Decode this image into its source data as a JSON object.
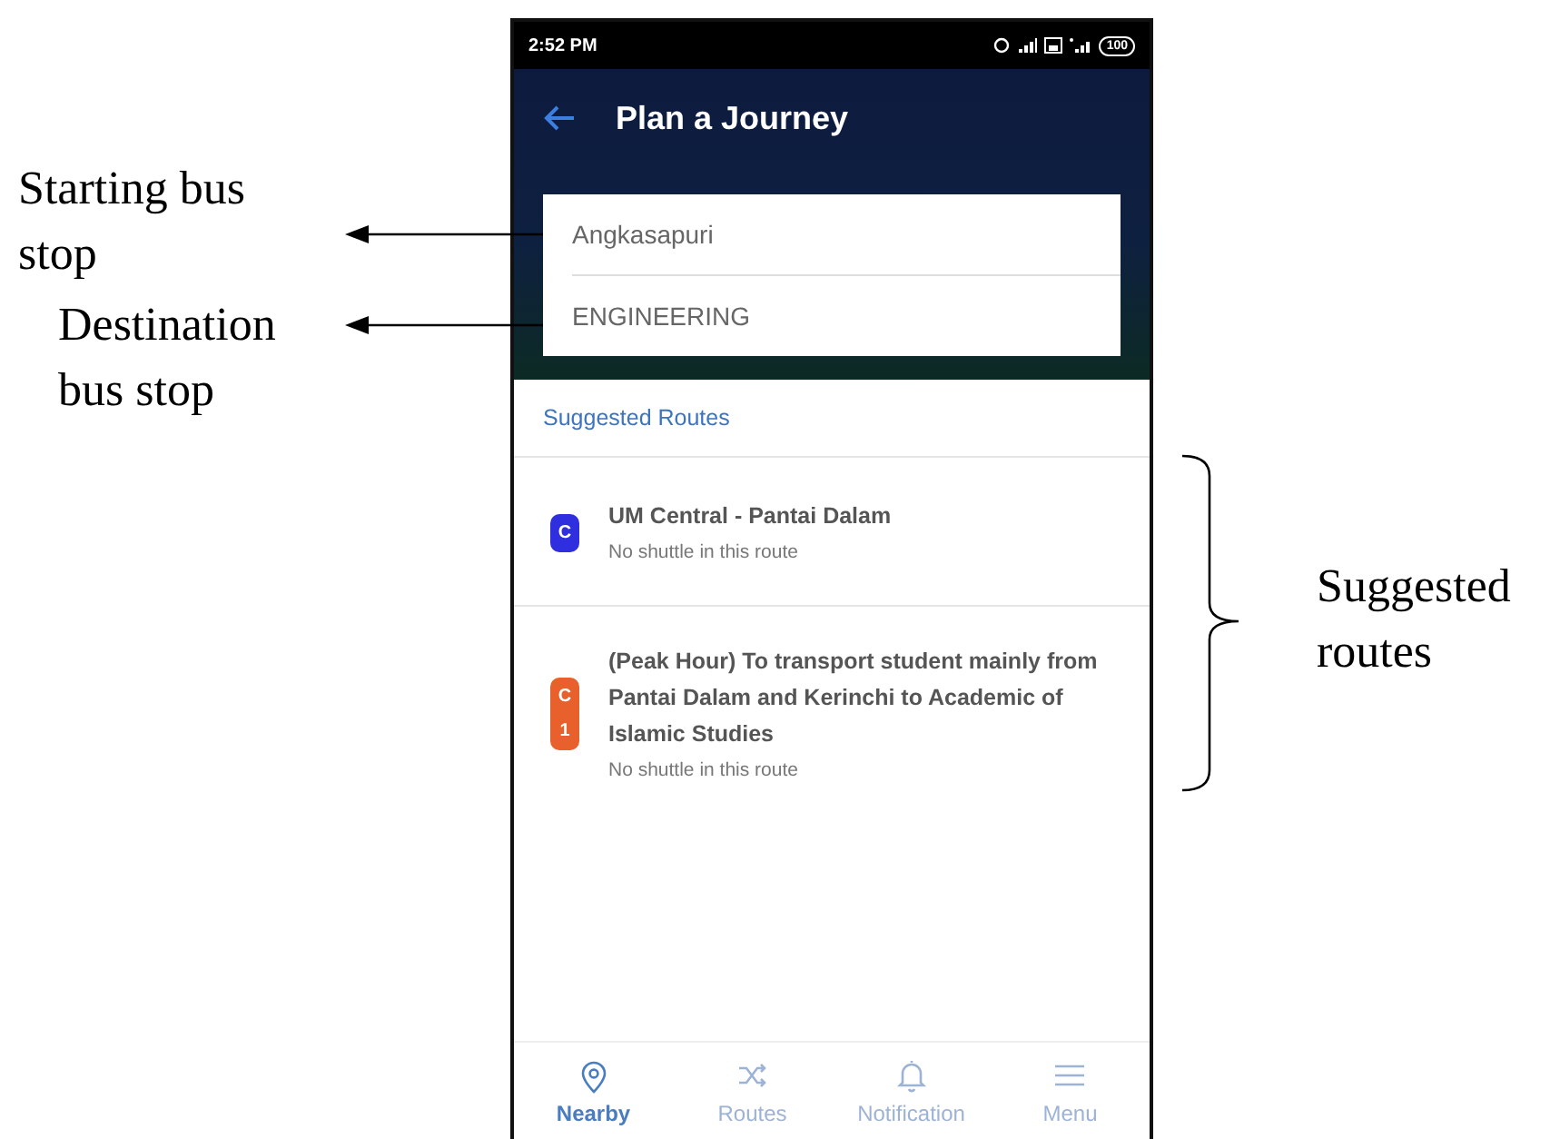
{
  "annotations": {
    "starting": "Starting bus stop",
    "destination": "Destination bus stop",
    "routes": "Suggested routes"
  },
  "status_bar": {
    "time": "2:52 PM",
    "battery": "100"
  },
  "header": {
    "title": "Plan a Journey"
  },
  "fields": [
    {
      "value": "Angkasapuri"
    },
    {
      "value": "ENGINEERING"
    }
  ],
  "section_title": "Suggested Routes",
  "routes": [
    {
      "badge": "C",
      "color": "#2f2fe0",
      "title": "UM Central - Pantai Dalam",
      "subtitle": "No shuttle in this route"
    },
    {
      "badge": "C1",
      "color": "#e8602c",
      "title": "(Peak Hour) To transport student mainly from Pantai Dalam and Kerinchi to Academic of Islamic Studies",
      "subtitle": "No shuttle in this route"
    }
  ],
  "nav": [
    {
      "label": "Nearby",
      "kind": "pin",
      "selected": true
    },
    {
      "label": "Routes",
      "kind": "shuffle",
      "selected": false
    },
    {
      "label": "Notification",
      "kind": "bell",
      "selected": false
    },
    {
      "label": "Menu",
      "kind": "menu",
      "selected": false
    }
  ]
}
